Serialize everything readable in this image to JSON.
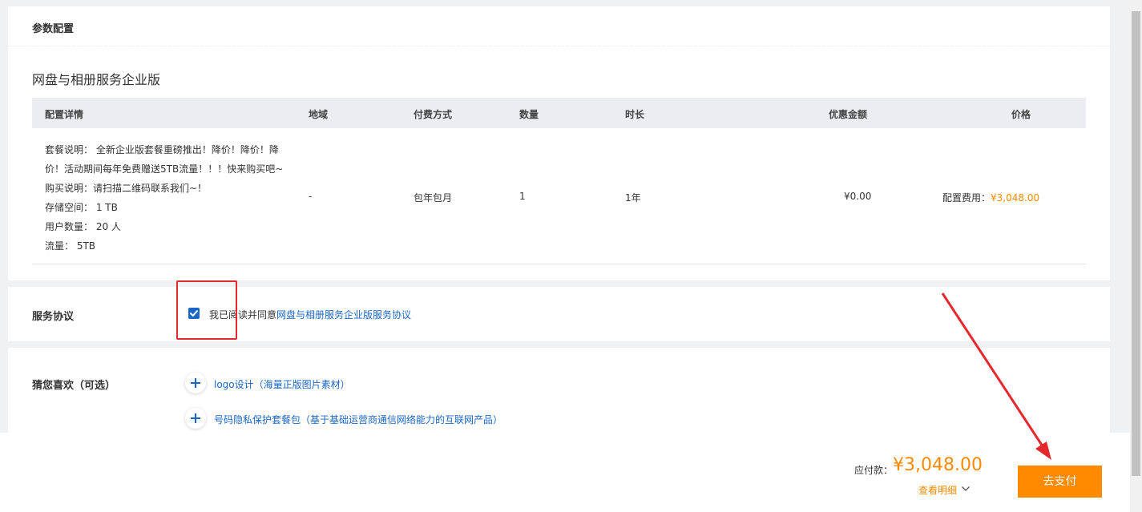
{
  "config_section": {
    "title": "参数配置",
    "product_name": "网盘与相册服务企业版",
    "table_headers": [
      "配置详情",
      "地域",
      "付费方式",
      "数量",
      "时长",
      "优惠金额",
      "价格"
    ],
    "details": [
      "套餐说明： 全新企业版套餐重磅推出！降价！降价！降",
      "价！活动期间每年免费赠送5TB流量！！！快来购买吧~",
      "购买说明：请扫描二维码联系我们~！",
      "存储空间： 1 TB",
      "用户数量： 20 人",
      "流量： 5TB"
    ],
    "region": "-",
    "payment_method": "包年包月",
    "quantity": "1",
    "duration": "1年",
    "discount": "¥0.00",
    "price_label": "配置费用：",
    "price_value": "¥3,048.00"
  },
  "agreement_section": {
    "title": "服务协议",
    "agree_text": "我已阅读并同意",
    "agree_link": "网盘与相册服务企业版服务协议",
    "checked": true
  },
  "recommend_section": {
    "title": "猜您喜欢（可选）",
    "items": [
      "logo设计（海量正版图片素材）",
      "号码隐私保护套餐包（基于基础运营商通信网络能力的互联网产品）"
    ]
  },
  "footer": {
    "pay_label": "应付款：",
    "pay_amount": "¥3,048.00",
    "detail_link": "查看明细",
    "pay_button": "去支付"
  },
  "colors": {
    "accent_orange": "#ff8a00",
    "link_blue": "#1a66c6",
    "annotation_red": "#e5282b"
  },
  "icons": {
    "checkbox": "check-icon",
    "add": "plus-icon",
    "expand": "chevron-down-icon"
  }
}
